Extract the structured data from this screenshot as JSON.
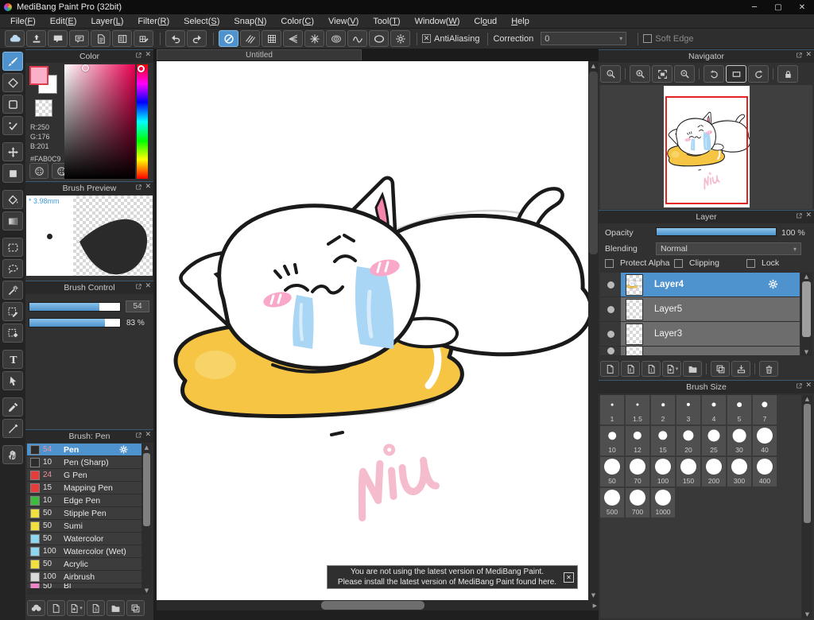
{
  "window": {
    "title": "MediBang Paint Pro (32bit)",
    "controls": {
      "minimize": "─",
      "maximize": "▢",
      "close": "✕"
    }
  },
  "menu": {
    "items": [
      {
        "pre": "File(",
        "key": "F",
        "post": ")"
      },
      {
        "pre": "Edit(",
        "key": "E",
        "post": ")"
      },
      {
        "pre": "Layer(",
        "key": "L",
        "post": ")"
      },
      {
        "pre": "Filter(",
        "key": "R",
        "post": ")"
      },
      {
        "pre": "Select(",
        "key": "S",
        "post": ")"
      },
      {
        "pre": "Snap(",
        "key": "N",
        "post": ")"
      },
      {
        "pre": "Color(",
        "key": "C",
        "post": ")"
      },
      {
        "pre": "View(",
        "key": "V",
        "post": ")"
      },
      {
        "pre": "Tool(",
        "key": "T",
        "post": ")"
      },
      {
        "pre": "Window(",
        "key": "W",
        "post": ")"
      },
      {
        "pre": "Cl",
        "key": "o",
        "post": "ud"
      },
      {
        "pre": "",
        "key": "H",
        "post": "elp"
      }
    ]
  },
  "toolbar": {
    "buttons": [
      {
        "name": "cloud",
        "accent": true
      },
      {
        "name": "publish"
      },
      {
        "name": "comment"
      },
      {
        "name": "message"
      },
      {
        "name": "document"
      },
      {
        "name": "panel-list"
      },
      {
        "name": "cell-pen"
      },
      {
        "name": "sep"
      },
      {
        "name": "undo"
      },
      {
        "name": "redo"
      },
      {
        "name": "sep"
      },
      {
        "name": "snap-off",
        "active": true
      },
      {
        "name": "snap-parallel"
      },
      {
        "name": "snap-grid"
      },
      {
        "name": "snap-vanishing"
      },
      {
        "name": "snap-radial"
      },
      {
        "name": "snap-concentric"
      },
      {
        "name": "snap-curve"
      },
      {
        "name": "snap-ellipse"
      },
      {
        "name": "snap-settings"
      }
    ],
    "antialiasing_label": "AntiAliasing",
    "antialiasing_checked": true,
    "correction_label": "Correction",
    "correction_value": "0",
    "soft_edge_label": "Soft Edge",
    "soft_edge_checked": false
  },
  "tools": [
    {
      "name": "brush",
      "active": true
    },
    {
      "name": "eraser"
    },
    {
      "name": "figure"
    },
    {
      "name": "dot"
    },
    {
      "name": "move"
    },
    {
      "name": "fill-figure"
    },
    {
      "name": "bucket"
    },
    {
      "name": "gradient"
    },
    {
      "name": "select"
    },
    {
      "name": "lasso"
    },
    {
      "name": "magic-wand"
    },
    {
      "name": "select-pen"
    },
    {
      "name": "select-eraser"
    },
    {
      "name": "text"
    },
    {
      "name": "operation"
    },
    {
      "name": "eyedropper"
    },
    {
      "name": "divide"
    },
    {
      "name": "hand"
    }
  ],
  "color_panel": {
    "title": "Color",
    "r": "R:250",
    "g": "G:176",
    "b": "B:201",
    "hex": "#FAB0C9",
    "foreground": "#FAB0C9"
  },
  "brush_preview": {
    "title": "Brush Preview",
    "size": "3.98mm",
    "marker": "*"
  },
  "brush_control": {
    "title": "Brush Control",
    "size_value": "54",
    "size_fill": 77,
    "opacity_value": "83 %",
    "opacity_fill": 83
  },
  "brush_list": {
    "title": "Brush: Pen",
    "items": [
      {
        "swatch": "#2d2d2d",
        "size": "54",
        "name": "Pen",
        "selected": true,
        "hot": true
      },
      {
        "swatch": "#2d2d2d",
        "size": "10",
        "name": "Pen (Sharp)"
      },
      {
        "swatch": "#e63c3c",
        "size": "24",
        "name": "G Pen",
        "hot": true
      },
      {
        "swatch": "#e63c3c",
        "size": "15",
        "name": "Mapping Pen"
      },
      {
        "swatch": "#3dbb3d",
        "size": "10",
        "name": "Edge Pen"
      },
      {
        "swatch": "#f0df3c",
        "size": "50",
        "name": "Stipple Pen"
      },
      {
        "swatch": "#f0df3c",
        "size": "50",
        "name": "Sumi"
      },
      {
        "swatch": "#8ed6ef",
        "size": "50",
        "name": "Watercolor"
      },
      {
        "swatch": "#8ed6ef",
        "size": "100",
        "name": "Watercolor (Wet)"
      },
      {
        "swatch": "#f0df3c",
        "size": "50",
        "name": "Acrylic"
      },
      {
        "swatch": "#d9d9d9",
        "size": "100",
        "name": "Airbrush"
      },
      {
        "swatch": "#ef83c9",
        "size": "50",
        "name": "Bl",
        "partial": true
      }
    ]
  },
  "canvas": {
    "tab": "Untitled"
  },
  "notification": {
    "line1": "You are not using the latest version of MediBang Paint.",
    "line2": "Please install the latest version of MediBang Paint found here.",
    "close": "✕"
  },
  "navigator": {
    "title": "Navigator",
    "buttons": [
      {
        "name": "zoom-actual"
      },
      {
        "name": "sep"
      },
      {
        "name": "zoom-in"
      },
      {
        "name": "fit-window"
      },
      {
        "name": "zoom-out"
      },
      {
        "name": "sep"
      },
      {
        "name": "rotate-ccw"
      },
      {
        "name": "rotate-reset",
        "active": true
      },
      {
        "name": "rotate-cw"
      },
      {
        "name": "sep"
      },
      {
        "name": "lock"
      }
    ]
  },
  "layer_panel": {
    "title": "Layer",
    "opacity_label": "Opacity",
    "opacity_value": "100 %",
    "blending_label": "Blending",
    "blending_value": "Normal",
    "checkboxes": [
      {
        "label": "Protect Alpha",
        "checked": false
      },
      {
        "label": "Clipping",
        "checked": false
      },
      {
        "label": "Lock",
        "checked": false
      }
    ],
    "layers": [
      {
        "name": "Layer4",
        "selected": true,
        "art": true
      },
      {
        "name": "Layer5"
      },
      {
        "name": "Layer3"
      },
      {
        "name": "",
        "partial": true
      }
    ],
    "buttons": [
      {
        "name": "new-layer"
      },
      {
        "name": "new-8bit-layer"
      },
      {
        "name": "new-1bit-layer"
      },
      {
        "name": "add-layer",
        "caret": true
      },
      {
        "name": "new-folder"
      },
      {
        "name": "sep"
      },
      {
        "name": "duplicate-layer"
      },
      {
        "name": "merge-layer"
      },
      {
        "name": "sep"
      },
      {
        "name": "delete-layer"
      }
    ]
  },
  "brush_size_panel": {
    "title": "Brush Size",
    "sizes": [
      "1",
      "1.5",
      "2",
      "3",
      "4",
      "5",
      "7",
      "10",
      "12",
      "15",
      "20",
      "25",
      "30",
      "40",
      "50",
      "70",
      "100",
      "150",
      "200",
      "300",
      "400",
      "500",
      "700",
      "1000"
    ]
  },
  "brush_footer": {
    "buttons": [
      {
        "name": "cloud-brush"
      },
      {
        "name": "new-brush"
      },
      {
        "name": "add-brush",
        "caret": true
      },
      {
        "name": "script-brush"
      },
      {
        "name": "brush-folder"
      },
      {
        "name": "duplicate-brush"
      }
    ]
  },
  "colors": {
    "accent": "#4f93ce",
    "cushion": "#f6c544",
    "tear": "#a9d6f4",
    "blush": "#f9a8c9",
    "signature": "#f5bccd",
    "ear_inner": "#f386aa",
    "outline": "#1a1a1a"
  }
}
